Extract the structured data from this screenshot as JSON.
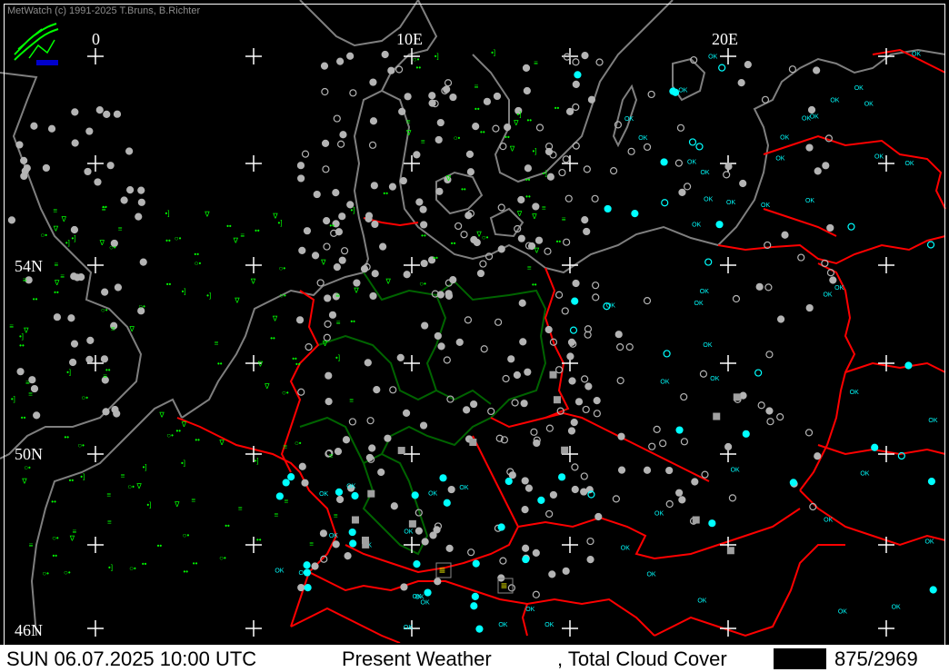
{
  "copyright": "MetWatch  (c) 1991-2025 T.Bruns, B.Richter",
  "lon_labels": [
    "0",
    "10E",
    "20E"
  ],
  "lat_labels": [
    "54N",
    "50N",
    "46N"
  ],
  "status_bar": {
    "date_time": "SUN 06.07.2025 10:00 UTC",
    "product": "Present Weather",
    "product2": ", Total Cloud Cover",
    "count": "875/2969"
  },
  "colors": {
    "background": "#000000",
    "coastline": "#7f7f7f",
    "borders": "#ff0000",
    "regions": "#006400",
    "station_gray": "#b4b4b4",
    "station_cyan": "#00ffff",
    "weather_green": "#00ff00",
    "weather_yellow": "#ffff00"
  },
  "icons": {
    "logo": "metwatch-logo-icon",
    "grid": "plus-grid-marker-icon"
  }
}
